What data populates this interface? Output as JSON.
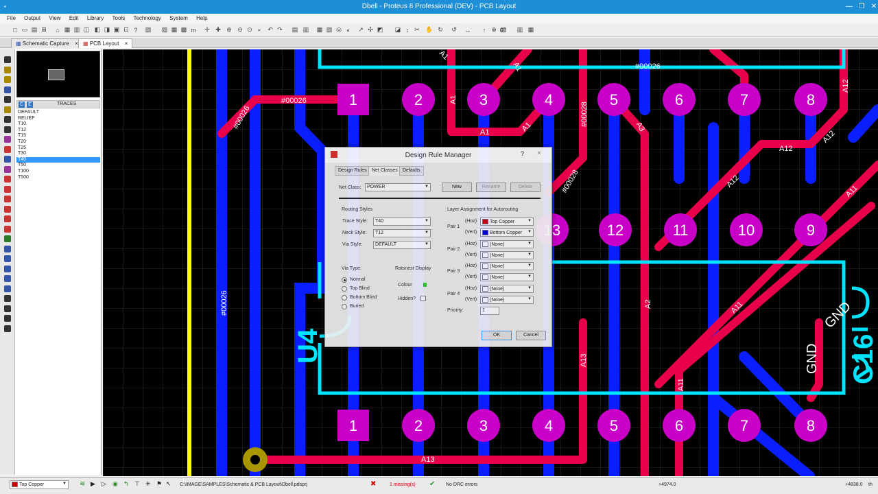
{
  "window": {
    "title": "Dbell - Proteus 8 Professional (DEV) - PCB Layout"
  },
  "menu": [
    "File",
    "Output",
    "View",
    "Edit",
    "Library",
    "Tools",
    "Technology",
    "System",
    "Help"
  ],
  "tabs": [
    {
      "label": "Schematic Capture",
      "close": "×"
    },
    {
      "label": "PCB Layout",
      "close": "×"
    }
  ],
  "toolbar_extra": {
    "rotation": "0°"
  },
  "traces_panel": {
    "letters": [
      "C",
      "E"
    ],
    "header": "TRACES",
    "items": [
      "DEFAULT",
      "RELIEF",
      "T10",
      "T12",
      "T15",
      "T20",
      "T25",
      "T30",
      "T40",
      "T50",
      "T100",
      "T500"
    ],
    "selected": "T40"
  },
  "pcb": {
    "pads_top": [
      "1",
      "2",
      "3",
      "4",
      "5",
      "6",
      "7",
      "8"
    ],
    "pads_mid": [
      "13",
      "12",
      "11",
      "10",
      "9"
    ],
    "pads_bottom": [
      "1",
      "2",
      "3",
      "4",
      "5",
      "6",
      "7",
      "8"
    ],
    "labels": {
      "net26a": "#00026",
      "net26b": "#00026",
      "net26c": "#00026",
      "net28a": "#00028",
      "net28b": "#00028",
      "a1a": "A1",
      "a1b": "A1",
      "a1c": "A1",
      "a1d": "A1",
      "a3": "A3",
      "a12a": "A12",
      "a12b": "A12",
      "a12c": "A12",
      "a12d": "A12",
      "a11a": "A11",
      "a11b": "A11",
      "a11c": "A11",
      "a2": "A2",
      "a13a": "A13",
      "a13b": "A13",
      "gnd1": "GND",
      "gnd2": "GND",
      "u4": "U4",
      "c16": "C16",
      "net_top": "#00026",
      "a1e": "A1"
    }
  },
  "dialog": {
    "title": "Design Rule Manager",
    "help": "?",
    "close": "×",
    "tabs": [
      "Design Rules",
      "Net Classes",
      "Defaults"
    ],
    "active_tab": "Net Classes",
    "net_class_label": "Net Class:",
    "net_class_value": "POWER",
    "buttons": {
      "new": "New",
      "rename": "Rename",
      "delete": "Delete",
      "ok": "OK",
      "cancel": "Cancel"
    },
    "routing_styles": {
      "header": "Routing Styles",
      "trace_label": "Trace Style:",
      "trace_value": "T40",
      "neck_label": "Neck Style:",
      "neck_value": "T12",
      "via_label": "Via Style:",
      "via_value": "DEFAULT"
    },
    "via_type": {
      "header": "Via Type:",
      "options": [
        "Normal",
        "Top Blind",
        "Bottom Blind",
        "Buried"
      ],
      "selected": "Normal"
    },
    "ratsnest": {
      "header": "Ratsnest Display",
      "colour_label": "Colour",
      "colour": "#33cc33",
      "hidden_label": "Hidden?"
    },
    "layers": {
      "header": "Layer Assignment for Autorouting",
      "hoz": "(Hoz)",
      "vert": "(Vert)",
      "pairs": [
        {
          "label": "Pair 1",
          "hoz": "Top Copper",
          "hoz_color": "#cc0000",
          "vert": "Bottom Copper",
          "vert_color": "#0000cc"
        },
        {
          "label": "Pair 2",
          "hoz": "(None)",
          "hoz_color": "#ffffff",
          "vert": "(None)",
          "vert_color": "#ffffff"
        },
        {
          "label": "Pair 3",
          "hoz": "(None)",
          "hoz_color": "#ffffff",
          "vert": "(None)",
          "vert_color": "#ffffff"
        },
        {
          "label": "Pair 4",
          "hoz": "(None)",
          "hoz_color": "#ffffff",
          "vert": "(None)",
          "vert_color": "#ffffff"
        }
      ],
      "priority_label": "Priority:",
      "priority_value": "1"
    }
  },
  "status": {
    "layer": "Top Copper",
    "path": "C:\\IMAGE\\SAMPLES\\Schematic & PCB Layout\\Dbell.pdsprj",
    "missing": "1 missing(s)",
    "drc": "No DRC errors",
    "coord_x": "+4974.0",
    "coord_y": "+4838.0",
    "unit": "th"
  },
  "colors": {
    "title_bar": "#1e8fd6",
    "top_copper": "#e8004a",
    "bottom_copper": "#0a1eff",
    "pad": "#c800c8",
    "silk": "#00e5ff"
  }
}
